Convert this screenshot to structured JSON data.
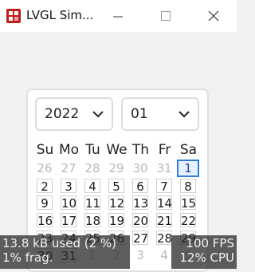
{
  "window": {
    "title": "LVGL Sim...",
    "controls": [
      "minimize-icon",
      "maximize-icon",
      "close-icon"
    ]
  },
  "calendar": {
    "year_value": "2022",
    "month_value": "01",
    "weekdays": [
      "Su",
      "Mo",
      "Tu",
      "We",
      "Th",
      "Fr",
      "Sa"
    ],
    "days": [
      {
        "label": "26",
        "muted": true
      },
      {
        "label": "27",
        "muted": true
      },
      {
        "label": "28",
        "muted": true
      },
      {
        "label": "29",
        "muted": true
      },
      {
        "label": "30",
        "muted": true
      },
      {
        "label": "31",
        "muted": true
      },
      {
        "label": "1",
        "selected": true
      },
      {
        "label": "2"
      },
      {
        "label": "3"
      },
      {
        "label": "4"
      },
      {
        "label": "5"
      },
      {
        "label": "6"
      },
      {
        "label": "7"
      },
      {
        "label": "8"
      },
      {
        "label": "9"
      },
      {
        "label": "10"
      },
      {
        "label": "11"
      },
      {
        "label": "12"
      },
      {
        "label": "13"
      },
      {
        "label": "14"
      },
      {
        "label": "15"
      },
      {
        "label": "16"
      },
      {
        "label": "17"
      },
      {
        "label": "18"
      },
      {
        "label": "19"
      },
      {
        "label": "20"
      },
      {
        "label": "21"
      },
      {
        "label": "22"
      },
      {
        "label": "23"
      },
      {
        "label": "24"
      },
      {
        "label": "25"
      },
      {
        "label": "26"
      },
      {
        "label": "27"
      },
      {
        "label": "28"
      },
      {
        "label": "29"
      },
      {
        "label": "30"
      },
      {
        "label": "31"
      },
      {
        "label": "1",
        "muted": true
      },
      {
        "label": "2",
        "muted": true
      },
      {
        "label": "3",
        "muted": true
      },
      {
        "label": "4",
        "muted": true
      },
      {
        "label": "5",
        "muted": true
      }
    ]
  },
  "perf_monitor": {
    "mem_used": "13.8 kB used (2 %)",
    "mem_frag": "1% frag.",
    "fps": "100 FPS",
    "cpu": "12% CPU"
  },
  "colors": {
    "selected_border": "#2f7fd8",
    "app_icon": "#c21d1d",
    "overlay": "#282828"
  }
}
